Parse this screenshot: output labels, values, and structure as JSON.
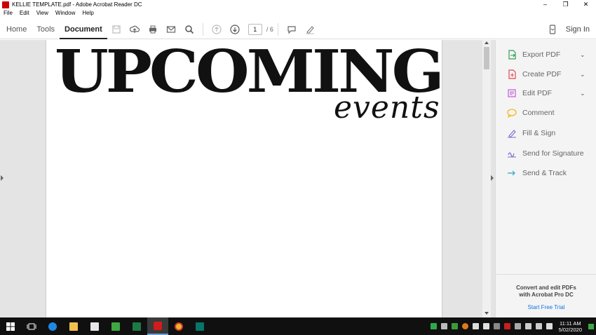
{
  "window": {
    "title": "KELLIE TEMPLATE.pdf - Adobe Acrobat Reader DC",
    "controls": {
      "minimize": "–",
      "restore": "❐",
      "close": "✕"
    }
  },
  "menu": [
    "File",
    "Edit",
    "View",
    "Window",
    "Help"
  ],
  "toolbar": {
    "tabs": {
      "home": "Home",
      "tools": "Tools",
      "document": "Document"
    },
    "page_current": "1",
    "page_total": "/ 6",
    "signin": "Sign In"
  },
  "document": {
    "heading": "UPCOMING",
    "script_word": "events"
  },
  "rightpane": {
    "items": [
      {
        "label": "Export PDF",
        "icon": "export-pdf-icon",
        "color": "#2da14d",
        "chevron": "⌄"
      },
      {
        "label": "Create PDF",
        "icon": "create-pdf-icon",
        "color": "#e34850",
        "chevron": "⌄"
      },
      {
        "label": "Edit PDF",
        "icon": "edit-pdf-icon",
        "color": "#c05bd6",
        "chevron": "⌄"
      },
      {
        "label": "Comment",
        "icon": "comment-icon",
        "color": "#f2b91e"
      },
      {
        "label": "Fill & Sign",
        "icon": "fill-sign-icon",
        "color": "#7b67d6"
      },
      {
        "label": "Send for Signature",
        "icon": "send-signature-icon",
        "color": "#7b67d6"
      },
      {
        "label": "Send & Track",
        "icon": "send-track-icon",
        "color": "#2aa5c8"
      }
    ],
    "promo": {
      "line1": "Convert and edit PDFs",
      "line2": "with Acrobat Pro DC",
      "cta": "Start Free Trial"
    }
  },
  "taskbar": {
    "time": "11:11 AM",
    "date": "5/02/2020"
  },
  "colors": {
    "accent": "#1473e6",
    "taskbar": "#101010"
  }
}
